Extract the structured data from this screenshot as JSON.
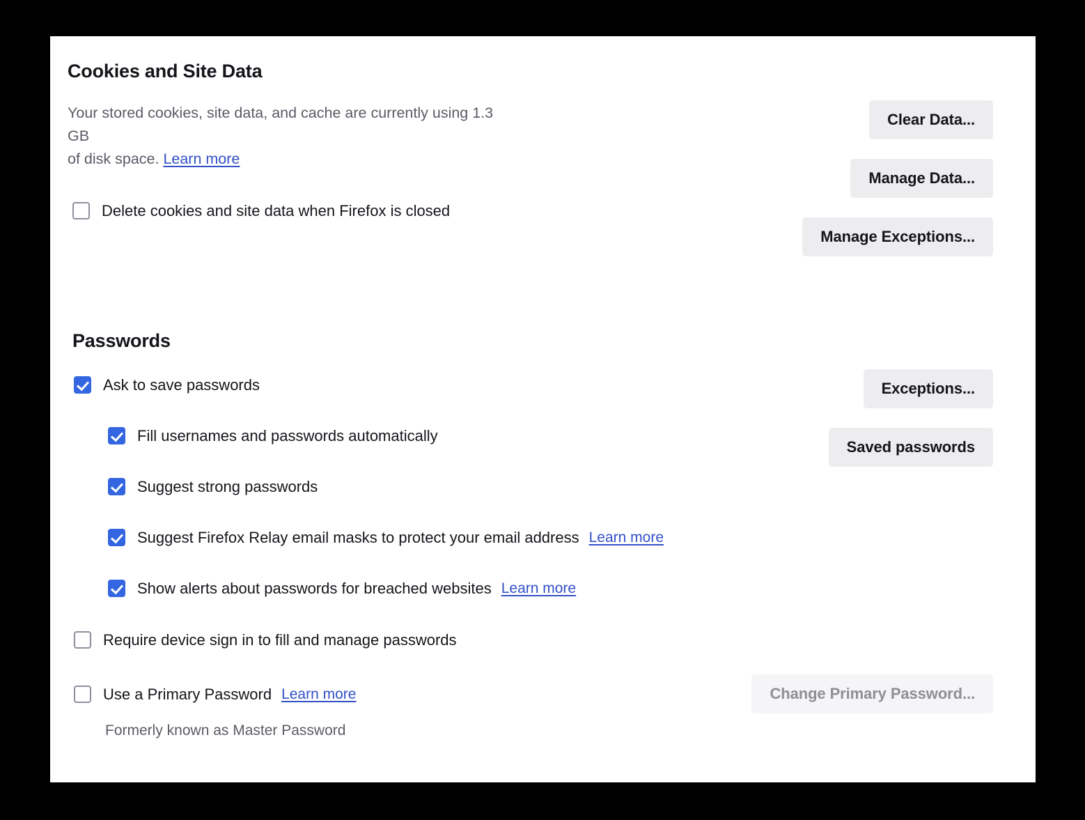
{
  "cookies_section": {
    "heading": "Cookies and Site Data",
    "description_line1": "Your stored cookies, site data, and cache are currently using 1.3 GB",
    "description_line2_prefix": "of disk space. ",
    "description_link": "Learn more",
    "storage_used": "1.3 GB",
    "checkbox": {
      "label": "Delete cookies and site data when Firefox is closed",
      "checked": false
    },
    "buttons": [
      {
        "label": "Clear Data...",
        "disabled": false
      },
      {
        "label": "Manage Data...",
        "disabled": false
      },
      {
        "label": "Manage Exceptions...",
        "disabled": false
      }
    ]
  },
  "passwords_section": {
    "heading": "Passwords",
    "items": [
      {
        "label": "Ask to save passwords",
        "checked": true,
        "indent": false,
        "link": null
      },
      {
        "label": "Fill usernames and passwords automatically",
        "checked": true,
        "indent": true,
        "link": null
      },
      {
        "label": "Suggest strong passwords",
        "checked": true,
        "indent": true,
        "link": null
      },
      {
        "label": "Suggest Firefox Relay email masks to protect your email address",
        "checked": true,
        "indent": true,
        "link": "Learn more"
      },
      {
        "label": "Show alerts about passwords for breached websites",
        "checked": true,
        "indent": true,
        "link": "Learn more"
      },
      {
        "label": "Require device sign in to fill and manage passwords",
        "checked": false,
        "indent": false,
        "link": null
      },
      {
        "label": "Use a Primary Password",
        "checked": false,
        "indent": false,
        "link": "Learn more"
      }
    ],
    "primary_password_note": "Formerly known as Master Password",
    "buttons": [
      {
        "label": "Exceptions...",
        "disabled": false
      },
      {
        "label": "Saved passwords",
        "disabled": false
      },
      {
        "label": "Change Primary Password...",
        "disabled": true
      }
    ]
  },
  "colors": {
    "accent_checkbox": "#3366e0",
    "link": "#3250c8",
    "button_bg": "#ededf0",
    "button_disabled_bg": "#f5f5f7",
    "text_primary": "#15141a",
    "text_secondary": "#5b5b66",
    "panel_bg": "#ffffff",
    "page_bg": "#000000"
  }
}
